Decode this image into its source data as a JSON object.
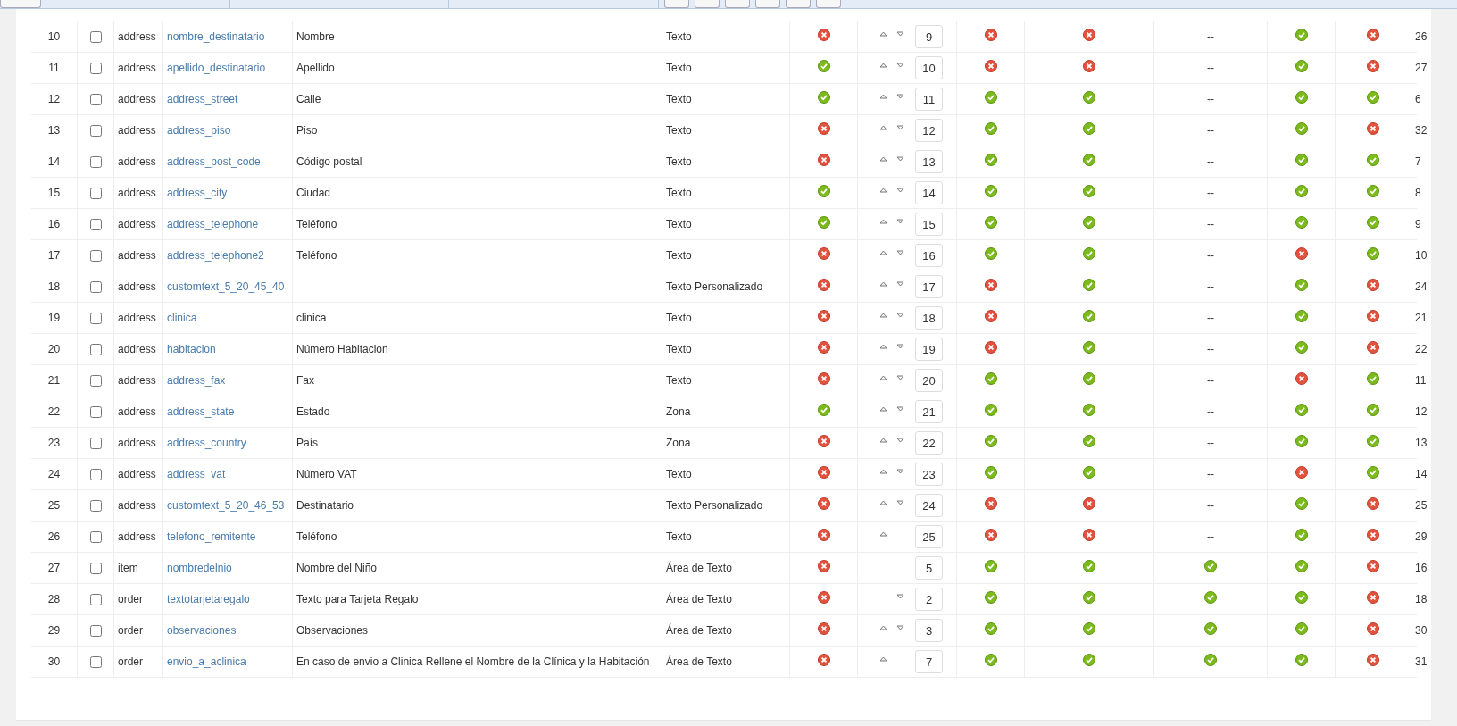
{
  "rows": [
    {
      "number": "10",
      "checked": false,
      "section": "address",
      "name": "nombre_destinatario",
      "label": "Nombre",
      "type": "Texto",
      "column_7": false,
      "move_up": true,
      "move_down": true,
      "order": "9",
      "column_9": false,
      "column_10": false,
      "column_11": "--",
      "column_12": true,
      "column_13": false,
      "id": "26"
    },
    {
      "number": "11",
      "checked": false,
      "section": "address",
      "name": "apellido_destinatario",
      "label": "Apellido",
      "type": "Texto",
      "column_7": true,
      "move_up": true,
      "move_down": true,
      "order": "10",
      "column_9": false,
      "column_10": false,
      "column_11": "--",
      "column_12": true,
      "column_13": false,
      "id": "27"
    },
    {
      "number": "12",
      "checked": false,
      "section": "address",
      "name": "address_street",
      "label": "Calle",
      "type": "Texto",
      "column_7": true,
      "move_up": true,
      "move_down": true,
      "order": "11",
      "column_9": true,
      "column_10": true,
      "column_11": "--",
      "column_12": true,
      "column_13": true,
      "id": "6"
    },
    {
      "number": "13",
      "checked": false,
      "section": "address",
      "name": "address_piso",
      "label": "Piso",
      "type": "Texto",
      "column_7": false,
      "move_up": true,
      "move_down": true,
      "order": "12",
      "column_9": true,
      "column_10": true,
      "column_11": "--",
      "column_12": true,
      "column_13": false,
      "id": "32"
    },
    {
      "number": "14",
      "checked": false,
      "section": "address",
      "name": "address_post_code",
      "label": "Código postal",
      "type": "Texto",
      "column_7": false,
      "move_up": true,
      "move_down": true,
      "order": "13",
      "column_9": true,
      "column_10": true,
      "column_11": "--",
      "column_12": true,
      "column_13": true,
      "id": "7"
    },
    {
      "number": "15",
      "checked": false,
      "section": "address",
      "name": "address_city",
      "label": "Ciudad",
      "type": "Texto",
      "column_7": true,
      "move_up": true,
      "move_down": true,
      "order": "14",
      "column_9": true,
      "column_10": true,
      "column_11": "--",
      "column_12": true,
      "column_13": true,
      "id": "8"
    },
    {
      "number": "16",
      "checked": false,
      "section": "address",
      "name": "address_telephone",
      "label": "Teléfono",
      "type": "Texto",
      "column_7": true,
      "move_up": true,
      "move_down": true,
      "order": "15",
      "column_9": true,
      "column_10": true,
      "column_11": "--",
      "column_12": true,
      "column_13": true,
      "id": "9"
    },
    {
      "number": "17",
      "checked": false,
      "section": "address",
      "name": "address_telephone2",
      "label": "Teléfono",
      "type": "Texto",
      "column_7": false,
      "move_up": true,
      "move_down": true,
      "order": "16",
      "column_9": true,
      "column_10": true,
      "column_11": "--",
      "column_12": false,
      "column_13": true,
      "id": "10"
    },
    {
      "number": "18",
      "checked": false,
      "section": "address",
      "name": "customtext_5_20_45_40",
      "type": "Texto Personalizado",
      "column_7": false,
      "move_up": true,
      "move_down": true,
      "order": "17",
      "column_9": false,
      "column_10": true,
      "column_11": "--",
      "column_12": true,
      "column_13": false,
      "id": "24"
    },
    {
      "number": "19",
      "checked": false,
      "section": "address",
      "name": "clinica",
      "label": "clinica",
      "type": "Texto",
      "column_7": false,
      "move_up": true,
      "move_down": true,
      "order": "18",
      "column_9": false,
      "column_10": true,
      "column_11": "--",
      "column_12": true,
      "column_13": false,
      "id": "21"
    },
    {
      "number": "20",
      "checked": false,
      "section": "address",
      "name": "habitacion",
      "label": "Número Habitacion",
      "type": "Texto",
      "column_7": false,
      "move_up": true,
      "move_down": true,
      "order": "19",
      "column_9": false,
      "column_10": true,
      "column_11": "--",
      "column_12": true,
      "column_13": false,
      "id": "22"
    },
    {
      "number": "21",
      "checked": false,
      "section": "address",
      "name": "address_fax",
      "label": "Fax",
      "type": "Texto",
      "column_7": false,
      "move_up": true,
      "move_down": true,
      "order": "20",
      "column_9": true,
      "column_10": true,
      "column_11": "--",
      "column_12": false,
      "column_13": true,
      "id": "11"
    },
    {
      "number": "22",
      "checked": false,
      "section": "address",
      "name": "address_state",
      "label": "Estado",
      "type": "Zona",
      "column_7": true,
      "move_up": true,
      "move_down": true,
      "order": "21",
      "column_9": true,
      "column_10": true,
      "column_11": "--",
      "column_12": true,
      "column_13": true,
      "id": "12"
    },
    {
      "number": "23",
      "checked": false,
      "section": "address",
      "name": "address_country",
      "label": "País",
      "type": "Zona",
      "column_7": false,
      "move_up": true,
      "move_down": true,
      "order": "22",
      "column_9": true,
      "column_10": true,
      "column_11": "--",
      "column_12": true,
      "column_13": true,
      "id": "13"
    },
    {
      "number": "24",
      "checked": false,
      "section": "address",
      "name": "address_vat",
      "label": "Número VAT",
      "type": "Texto",
      "column_7": false,
      "move_up": true,
      "move_down": true,
      "order": "23",
      "column_9": true,
      "column_10": true,
      "column_11": "--",
      "column_12": false,
      "column_13": true,
      "id": "14"
    },
    {
      "number": "25",
      "checked": false,
      "section": "address",
      "name": "customtext_5_20_46_53",
      "label": "Destinatario",
      "type": "Texto Personalizado",
      "column_7": false,
      "move_up": true,
      "move_down": true,
      "order": "24",
      "column_9": false,
      "column_10": false,
      "column_11": "--",
      "column_12": true,
      "column_13": false,
      "id": "25"
    },
    {
      "number": "26",
      "checked": false,
      "section": "address",
      "name": "telefono_remitente",
      "label": "Teléfono",
      "type": "Texto",
      "column_7": false,
      "move_up": true,
      "move_down": false,
      "order": "25",
      "column_9": false,
      "column_10": false,
      "column_11": "--",
      "column_12": true,
      "column_13": false,
      "id": "29"
    },
    {
      "number": "27",
      "checked": false,
      "section": "item",
      "name": "nombredelnio",
      "label": "Nombre del Niño",
      "type": "Área de Texto",
      "column_7": false,
      "move_up": false,
      "move_down": false,
      "order": "5",
      "column_9": true,
      "column_10": true,
      "column_11": true,
      "column_12": true,
      "column_13": false,
      "id": "16"
    },
    {
      "number": "28",
      "checked": false,
      "section": "order",
      "name": "textotarjetaregalo",
      "label": "Texto para Tarjeta Regalo",
      "type": "Área de Texto",
      "column_7": false,
      "move_up": false,
      "move_down": true,
      "order": "2",
      "column_9": true,
      "column_10": true,
      "column_11": true,
      "column_12": true,
      "column_13": false,
      "id": "18"
    },
    {
      "number": "29",
      "checked": false,
      "section": "order",
      "name": "observaciones",
      "label": "Observaciones",
      "type": "Área de Texto",
      "column_7": false,
      "move_up": true,
      "move_down": true,
      "order": "3",
      "column_9": true,
      "column_10": true,
      "column_11": true,
      "column_12": true,
      "column_13": false,
      "id": "30"
    },
    {
      "number": "30",
      "checked": false,
      "section": "order",
      "name": "envio_a_aclinica",
      "label": "En caso de envio a Clinica Rellene el Nombre de la Clínica y la Habitación",
      "type": "Área de Texto",
      "column_7": false,
      "move_up": true,
      "move_down": false,
      "order": "7",
      "column_9": true,
      "column_10": true,
      "column_11": true,
      "column_12": true,
      "column_13": false,
      "id": "31"
    }
  ]
}
